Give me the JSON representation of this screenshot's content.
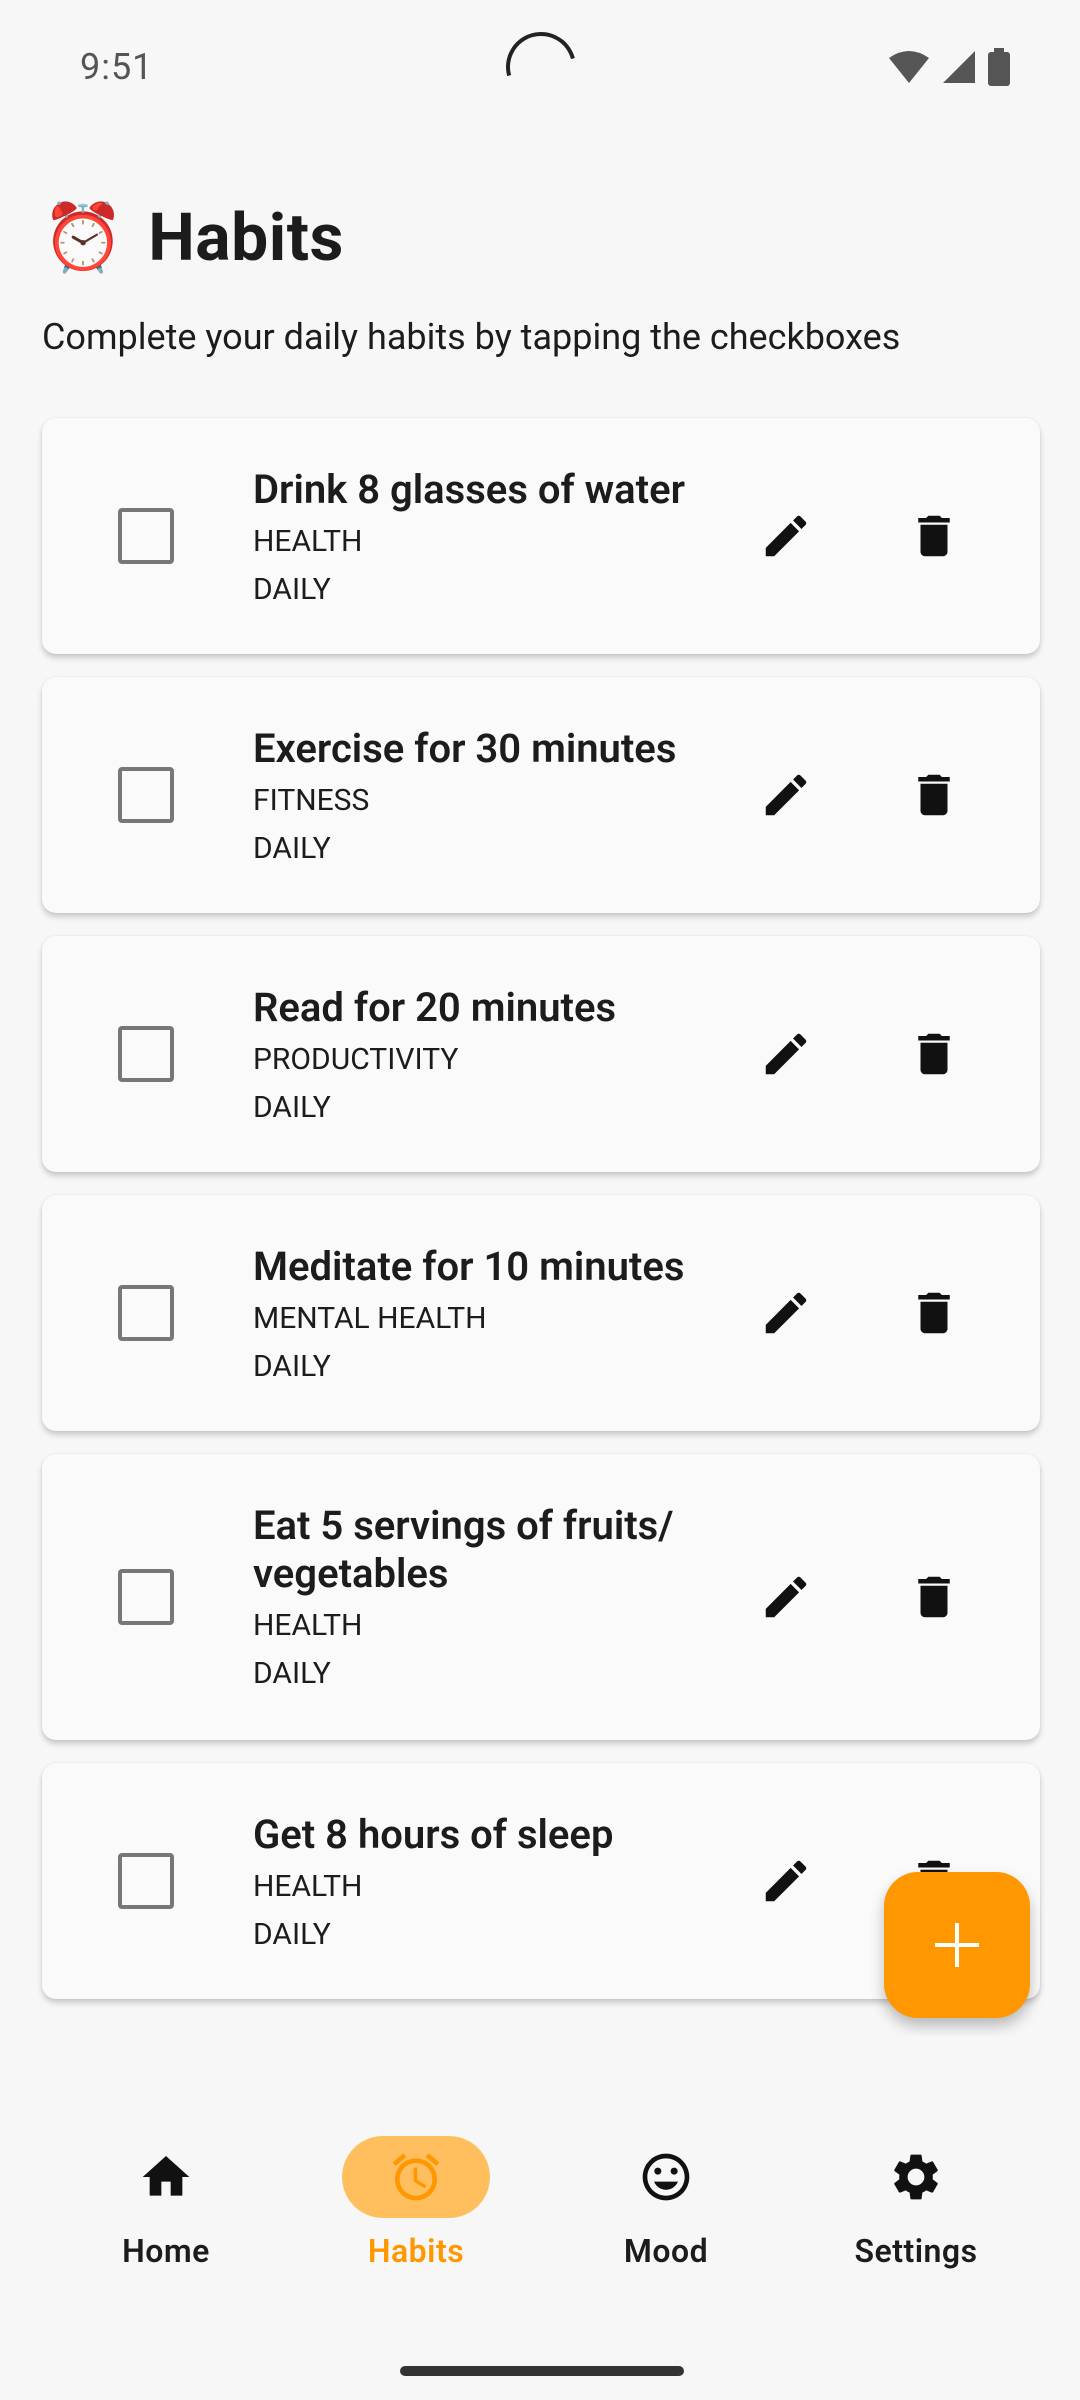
{
  "status_bar": {
    "time": "9:51",
    "icons": [
      "wifi-icon",
      "cell-signal-icon",
      "battery-icon"
    ]
  },
  "header": {
    "emoji": "⏰",
    "title": "Habits",
    "subtitle": "Complete your daily habits by tapping the checkboxes"
  },
  "habits": [
    {
      "title": "Drink 8 glasses of water",
      "category": "HEALTH",
      "frequency": "DAILY",
      "checked": false
    },
    {
      "title": "Exercise for 30 minutes",
      "category": "FITNESS",
      "frequency": "DAILY",
      "checked": false
    },
    {
      "title": "Read for 20 minutes",
      "category": "PRODUCTIVITY",
      "frequency": "DAILY",
      "checked": false
    },
    {
      "title": "Meditate for 10 minutes",
      "category": "MENTAL HEALTH",
      "frequency": "DAILY",
      "checked": false
    },
    {
      "title": "Eat 5 servings of fruits/\nvegetables",
      "category": "HEALTH",
      "frequency": "DAILY",
      "checked": false
    },
    {
      "title": "Get 8 hours of sleep",
      "category": "HEALTH",
      "frequency": "DAILY",
      "checked": false
    }
  ],
  "fab": {
    "icon": "plus-icon"
  },
  "bottom_nav": [
    {
      "label": "Home",
      "icon": "home-icon",
      "active": false
    },
    {
      "label": "Habits",
      "icon": "alarm-clock-icon",
      "active": true
    },
    {
      "label": "Mood",
      "icon": "smiley-icon",
      "active": false
    },
    {
      "label": "Settings",
      "icon": "gear-icon",
      "active": false
    }
  ],
  "colors": {
    "accent": "#ff9800",
    "accent_light": "#ffbf5e",
    "background": "#f7f7f7",
    "card": "#fafafa",
    "text": "#1c1c1c"
  }
}
